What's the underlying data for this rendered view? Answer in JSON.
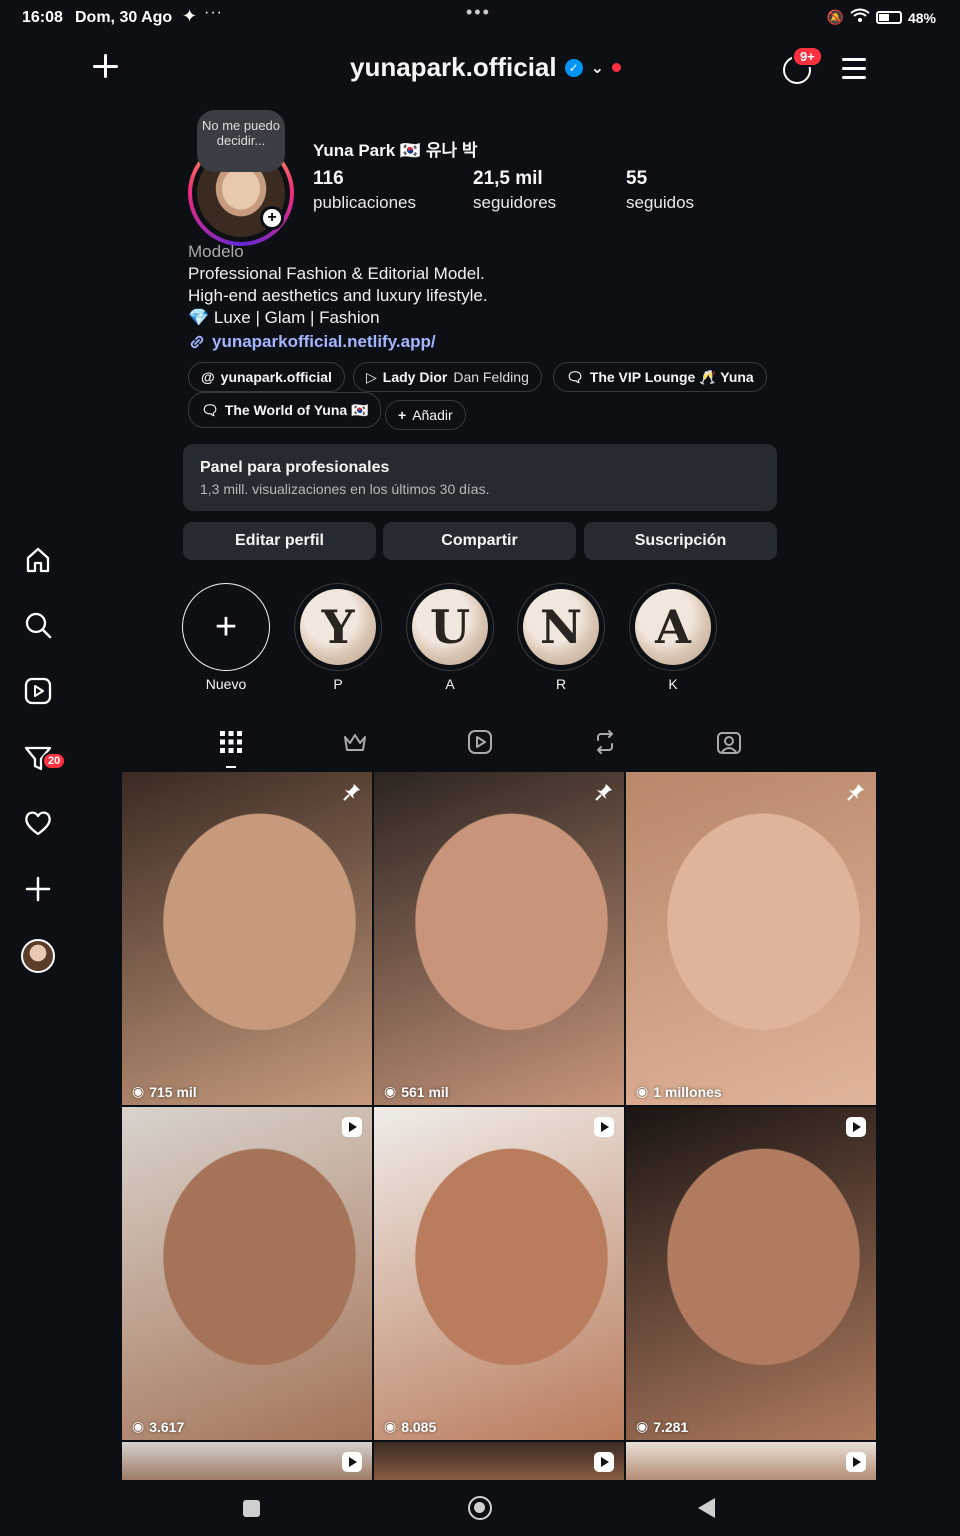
{
  "status_bar": {
    "time": "16:08",
    "date": "Dom, 30 Ago",
    "battery": "48%"
  },
  "header": {
    "username": "yunapark.official",
    "notifications_badge": "9+"
  },
  "profile": {
    "note": "No me puedo decidir...",
    "display_name": "Yuna Park 🇰🇷 유나 박",
    "stats": [
      {
        "value": "116",
        "label": "publicaciones"
      },
      {
        "value": "21,5 mil",
        "label": "seguidores"
      },
      {
        "value": "55",
        "label": "seguidos"
      }
    ],
    "category": "Modelo",
    "bio": [
      "Professional Fashion & Editorial Model.",
      "High-end aesthetics and luxury lifestyle.",
      "💎 Luxe | Glam | Fashion"
    ],
    "link": "yunaparkofficial.netlify.app/"
  },
  "chips": [
    {
      "label": "yunapark.official",
      "extra": "",
      "icon": "threads-icon"
    },
    {
      "label": "Lady Dior",
      "extra": "Dan Felding",
      "icon": "play-icon"
    },
    {
      "label": "The VIP Lounge 🥂 Yuna",
      "extra": "",
      "icon": "chat-icon"
    },
    {
      "label": "The World of Yuna 🇰🇷",
      "extra": "",
      "icon": "chat-icon"
    },
    {
      "label": "Añadir",
      "extra": "",
      "icon": "plus-icon"
    }
  ],
  "pro_panel": {
    "title": "Panel para profesionales",
    "subtitle": "1,3 mill. visualizaciones en los últimos 30 días."
  },
  "buttons": {
    "edit": "Editar perfil",
    "share": "Compartir",
    "subscription": "Suscripción"
  },
  "highlights": [
    {
      "letter": "",
      "label": "Nuevo"
    },
    {
      "letter": "Y",
      "label": "P"
    },
    {
      "letter": "U",
      "label": "A"
    },
    {
      "letter": "N",
      "label": "R"
    },
    {
      "letter": "A",
      "label": "K"
    }
  ],
  "tabs": [
    "grid-icon",
    "crown-icon",
    "reels-icon",
    "repost-icon",
    "tagged-icon"
  ],
  "posts": [
    {
      "views": "715 mil",
      "corner": "pin-icon",
      "tone": [
        "#3a2a22",
        "#c79a7c"
      ]
    },
    {
      "views": "561 mil",
      "corner": "pin-icon",
      "tone": [
        "#2c2420",
        "#c8957a"
      ]
    },
    {
      "views": "1 millones",
      "corner": "pin-icon",
      "tone": [
        "#b9876a",
        "#e0b49a"
      ]
    },
    {
      "views": "3.617",
      "corner": "reel-icon",
      "tone": [
        "#d9d3cc",
        "#a57458"
      ]
    },
    {
      "views": "8.085",
      "corner": "reel-icon",
      "tone": [
        "#f0ece8",
        "#b97c5c"
      ]
    },
    {
      "views": "7.281",
      "corner": "reel-icon",
      "tone": [
        "#1a1412",
        "#b07b5e"
      ]
    }
  ],
  "left_nav": {
    "filter_badge": "20"
  }
}
